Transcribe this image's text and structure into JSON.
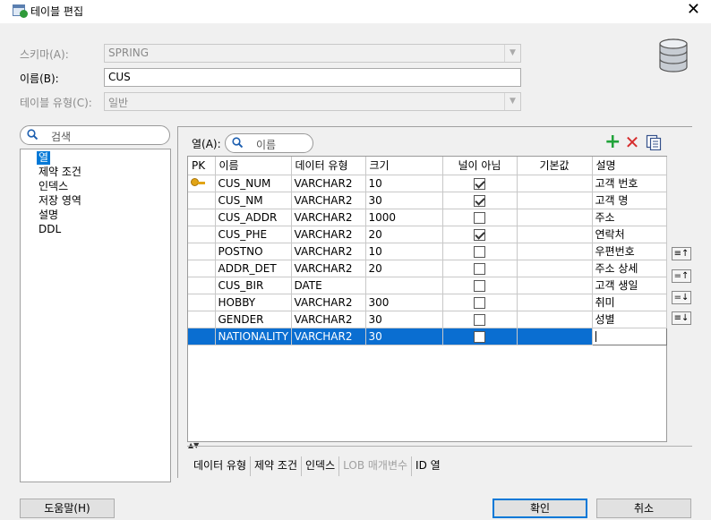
{
  "window": {
    "title": "테이블 편집",
    "close": "✕"
  },
  "form": {
    "schema_label": "스키마(A):",
    "schema_value": "SPRING",
    "name_label": "이름(B):",
    "name_value": "CUS",
    "type_label": "테이블 유형(C):",
    "type_value": "일반"
  },
  "nav": {
    "search_placeholder": "검색",
    "items": [
      "열",
      "제약 조건",
      "인덱스",
      "저장 영역",
      "설명",
      "DDL"
    ]
  },
  "columns_panel": {
    "label": "열(A):",
    "search_placeholder": "이름",
    "headers": [
      "PK",
      "이름",
      "데이터 유형",
      "크기",
      "널이 아님",
      "기본값",
      "설명"
    ],
    "rows": [
      {
        "pk": true,
        "name": "CUS_NUM",
        "type": "VARCHAR2",
        "size": "10",
        "notnull": true,
        "default": "",
        "desc": "고객 번호"
      },
      {
        "pk": false,
        "name": "CUS_NM",
        "type": "VARCHAR2",
        "size": "30",
        "notnull": true,
        "default": "",
        "desc": "고객 명"
      },
      {
        "pk": false,
        "name": "CUS_ADDR",
        "type": "VARCHAR2",
        "size": "1000",
        "notnull": false,
        "default": "",
        "desc": "주소"
      },
      {
        "pk": false,
        "name": "CUS_PHE",
        "type": "VARCHAR2",
        "size": "20",
        "notnull": true,
        "default": "",
        "desc": "연락처"
      },
      {
        "pk": false,
        "name": "POSTNO",
        "type": "VARCHAR2",
        "size": "10",
        "notnull": false,
        "default": "",
        "desc": "우편번호"
      },
      {
        "pk": false,
        "name": "ADDR_DET",
        "type": "VARCHAR2",
        "size": "20",
        "notnull": false,
        "default": "",
        "desc": "주소 상세"
      },
      {
        "pk": false,
        "name": "CUS_BIR",
        "type": "DATE",
        "size": "",
        "notnull": false,
        "default": "",
        "desc": "고객 생일"
      },
      {
        "pk": false,
        "name": "HOBBY",
        "type": "VARCHAR2",
        "size": "300",
        "notnull": false,
        "default": "",
        "desc": "취미"
      },
      {
        "pk": false,
        "name": "GENDER",
        "type": "VARCHAR2",
        "size": "30",
        "notnull": false,
        "default": "",
        "desc": "성별"
      },
      {
        "pk": false,
        "name": "NATIONALITY",
        "type": "VARCHAR2",
        "size": "30",
        "notnull": false,
        "default": "",
        "desc": "",
        "selected": true
      }
    ]
  },
  "bottom_tabs": [
    "데이터 유형",
    "제약 조건",
    "인덱스",
    "LOB 매개변수",
    "ID 열"
  ],
  "buttons": {
    "help": "도움말(H)",
    "ok": "확인",
    "cancel": "취소"
  },
  "colors": {
    "selection": "#0a6ed1",
    "add": "#21a33a",
    "delete": "#d62d2d"
  }
}
